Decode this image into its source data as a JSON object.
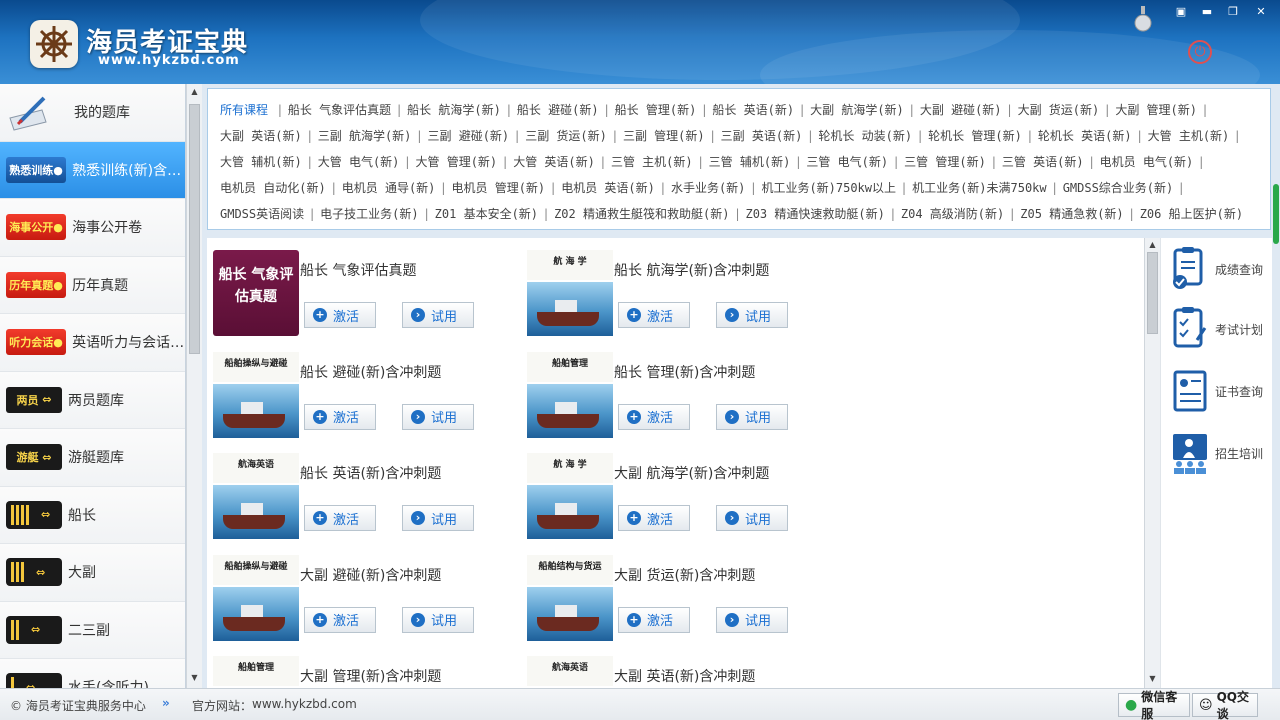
{
  "app": {
    "title": "海员考证宝典",
    "url": "www.hykzbd.com"
  },
  "sidebar": {
    "items": [
      {
        "tag": "",
        "label": "我的题库"
      },
      {
        "tag": "熟悉训练●",
        "label": "熟悉训练(新)含冲刺题"
      },
      {
        "tag": "海事公开●",
        "label": "海事公开卷"
      },
      {
        "tag": "历年真题●",
        "label": "历年真题"
      },
      {
        "tag": "听力会话●",
        "label": "英语听力与会话(新)"
      },
      {
        "tag": "两员",
        "label": "两员题库"
      },
      {
        "tag": "游艇",
        "label": "游艇题库"
      },
      {
        "tag": "",
        "label": "船长"
      },
      {
        "tag": "",
        "label": "大副"
      },
      {
        "tag": "",
        "label": "二三副"
      },
      {
        "tag": "",
        "label": "水手(含听力)"
      }
    ]
  },
  "filter": {
    "current": "所有课程",
    "courses": [
      "船长 气象评估真题",
      "船长 航海学(新)",
      "船长 避碰(新)",
      "船长 管理(新)",
      "船长 英语(新)",
      "大副 航海学(新)",
      "大副 避碰(新)",
      "大副 货运(新)",
      "大副 管理(新)",
      "大副 英语(新)",
      "三副 航海学(新)",
      "三副 避碰(新)",
      "三副 货运(新)",
      "三副 管理(新)",
      "三副 英语(新)",
      "轮机长 动装(新)",
      "轮机长 管理(新)",
      "轮机长 英语(新)",
      "大管 主机(新)",
      "大管 辅机(新)",
      "大管 电气(新)",
      "大管 管理(新)",
      "大管 英语(新)",
      "三管 主机(新)",
      "三管 辅机(新)",
      "三管 电气(新)",
      "三管 管理(新)",
      "三管 英语(新)",
      "电机员 电气(新)",
      "电机员 自动化(新)",
      "电机员 通导(新)",
      "电机员 管理(新)",
      "电机员 英语(新)",
      "水手业务(新)",
      "机工业务(新)750kw以上",
      "机工业务(新)未满750kw",
      "GMDSS综合业务(新)",
      "GMDSS英语阅读",
      "电子技工业务(新)",
      "Z01 基本安全(新)",
      "Z02 精通救生艇筏和救助艇(新)",
      "Z03 精通快速救助艇(新)",
      "Z04 高级消防(新)",
      "Z05 精通急救(新)",
      "Z06 船上医护(新)"
    ]
  },
  "cards": [
    {
      "title": "船长 气象评估真题",
      "cover": "船长 气象评估真题"
    },
    {
      "title": "船长 航海学(新)含冲刺题",
      "cover": "航 海 学"
    },
    {
      "title": "船长 避碰(新)含冲刺题",
      "cover": "船舶操纵与避碰"
    },
    {
      "title": "船长 管理(新)含冲刺题",
      "cover": "船舶管理"
    },
    {
      "title": "船长 英语(新)含冲刺题",
      "cover": "航海英语"
    },
    {
      "title": "大副 航海学(新)含冲刺题",
      "cover": "航 海 学"
    },
    {
      "title": "大副 避碰(新)含冲刺题",
      "cover": "船舶操纵与避碰"
    },
    {
      "title": "大副 货运(新)含冲刺题",
      "cover": "船舶结构与货运"
    },
    {
      "title": "大副 管理(新)含冲刺题",
      "cover": "船舶管理"
    },
    {
      "title": "大副 英语(新)含冲刺题",
      "cover": "航海英语"
    }
  ],
  "buttons": {
    "activate": "激活",
    "trial": "试用"
  },
  "right_panel": [
    "成绩查询",
    "考试计划",
    "证书查询",
    "招生培训"
  ],
  "status": {
    "copyright": "© 海员考证宝典服务中心",
    "site_label": "官方网站：",
    "site": "www.hykzbd.com",
    "wechat": "微信客服",
    "qq": "QQ交谈"
  },
  "colors": {
    "accent": "#1a6fd1",
    "title_blue": "#1d72c0",
    "tag_red": "#e02a1c"
  }
}
